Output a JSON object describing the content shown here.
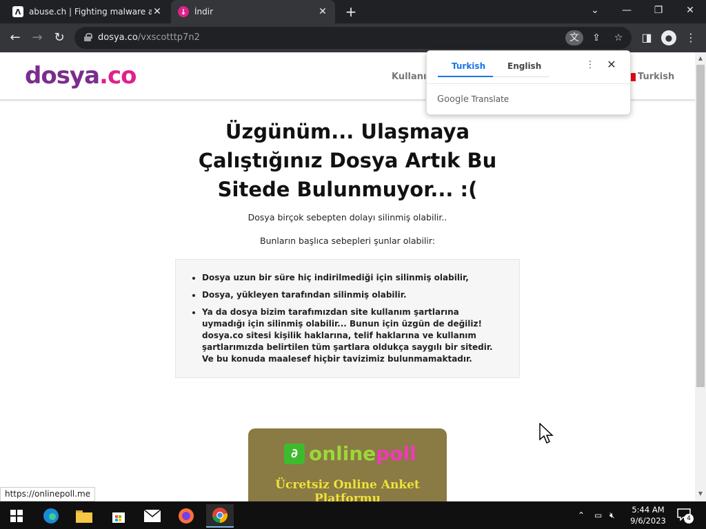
{
  "browser": {
    "tabs": [
      {
        "title": "abuse.ch | Fighting malware and",
        "active": false
      },
      {
        "title": "İndir",
        "active": true
      }
    ],
    "url_host": "dosya.co",
    "url_path": "/vxscotttp7n2",
    "status_url": "https://onlinepoll.me"
  },
  "site": {
    "logo_part1": "dosya",
    "logo_part2": ".co",
    "nav_user": "Kullanıcı",
    "lang": "Turkish",
    "headline": "Üzgünüm... Ulaşmaya Çalıştığınız Dosya Artık Bu Sitede Bulunmuyor... :(",
    "subtext1": "Dosya birçok sebepten dolayı silinmiş olabilir..",
    "subtext2": "Bunların başlıca sebepleri şunlar olabilir:",
    "reasons": [
      "Dosya uzun bir süre hiç indirilmediği için silinmiş olabilir,",
      "Dosya, yükleyen tarafından silinmiş olabilir.",
      "Ya da dosya bizim tarafımızdan site kullanım şartlarına uymadığı için silinmiş olabilir... Bunun için üzgün de değiliz! dosya.co sitesi kişilik haklarına, telif haklarına ve kullanım şartlarımızda belirtilen tüm şartlara oldukça saygılı bir sitedir. Ve bu konuda maalesef hiçbir tavizimiz bulunmamaktadır."
    ],
    "ad_word1": "online",
    "ad_word2": "poll",
    "ad_tagline": "Ücretsiz Online Anket Platformu"
  },
  "translate_popup": {
    "tab_source": "Turkish",
    "tab_target": "English",
    "brand_google": "Google",
    "brand_translate": "Translate"
  },
  "taskbar": {
    "time": "5:44 AM",
    "date": "9/6/2023",
    "notification_count": "4"
  },
  "colors": {
    "chrome_dark": "#202124",
    "chrome_toolbar": "#35363a",
    "logo_purple": "#7b2d8e",
    "logo_pink": "#e0218a",
    "translate_blue": "#1a73e8"
  }
}
